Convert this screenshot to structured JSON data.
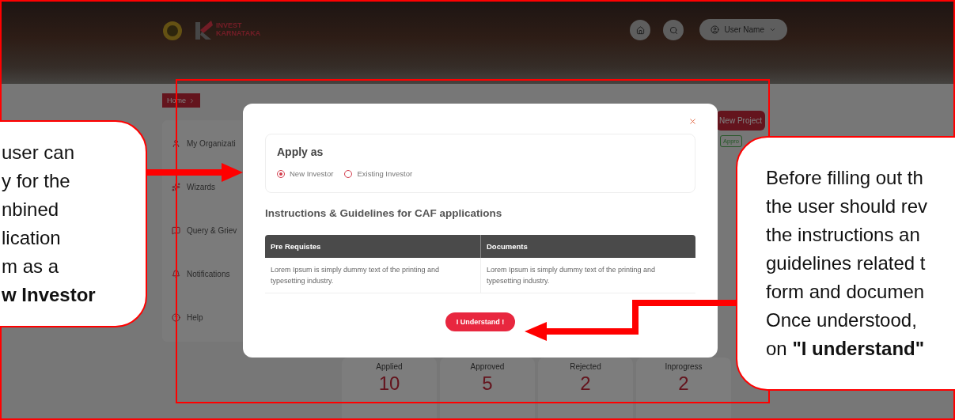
{
  "header": {
    "brand": [
      "INVEST",
      "KARNATAKA"
    ],
    "user_menu": "User Name"
  },
  "breadcrumb": [
    "Home"
  ],
  "sidebar": {
    "items": [
      {
        "label": "My Organizati",
        "kind": "user"
      },
      {
        "label": "Wizards",
        "kind": "wizard"
      },
      {
        "label": "Query & Griev",
        "kind": "chat"
      },
      {
        "label": "Notifications",
        "kind": "bell"
      },
      {
        "label": "Help",
        "kind": "help"
      }
    ]
  },
  "dashboard": {
    "new_project_button": "New Project",
    "status_badge": "Appro",
    "stats": [
      {
        "label": "Applied",
        "value": "10"
      },
      {
        "label": "Approved",
        "value": "5"
      },
      {
        "label": "Rejected",
        "value": "2"
      },
      {
        "label": "Inprogress",
        "value": "2"
      }
    ]
  },
  "modal": {
    "apply_as": {
      "title": "Apply as",
      "options": [
        {
          "label": "New Investor",
          "selected": true
        },
        {
          "label": "Existing Investor",
          "selected": false
        }
      ]
    },
    "instructions_title": "Instructions & Guidelines for CAF applications",
    "table": {
      "columns": [
        "Pre Requistes",
        "Documents"
      ],
      "rows": [
        [
          "Lorem Ipsum is simply dummy text of the printing and typesetting industry.",
          "Lorem Ipsum is simply dummy text of the printing and typesetting industry."
        ]
      ]
    },
    "confirm_button": "I Understand !"
  },
  "annotations": [
    {
      "lines": [
        "user can",
        "y for the",
        "nbined",
        "lication",
        "m as a",
        "**w Investor**"
      ]
    },
    {
      "lines": [
        "Before filling out th",
        "the user should rev",
        "the instructions an",
        "guidelines related t",
        "form and documen",
        "Once understood,",
        "on **\"I understand\"**"
      ]
    }
  ]
}
